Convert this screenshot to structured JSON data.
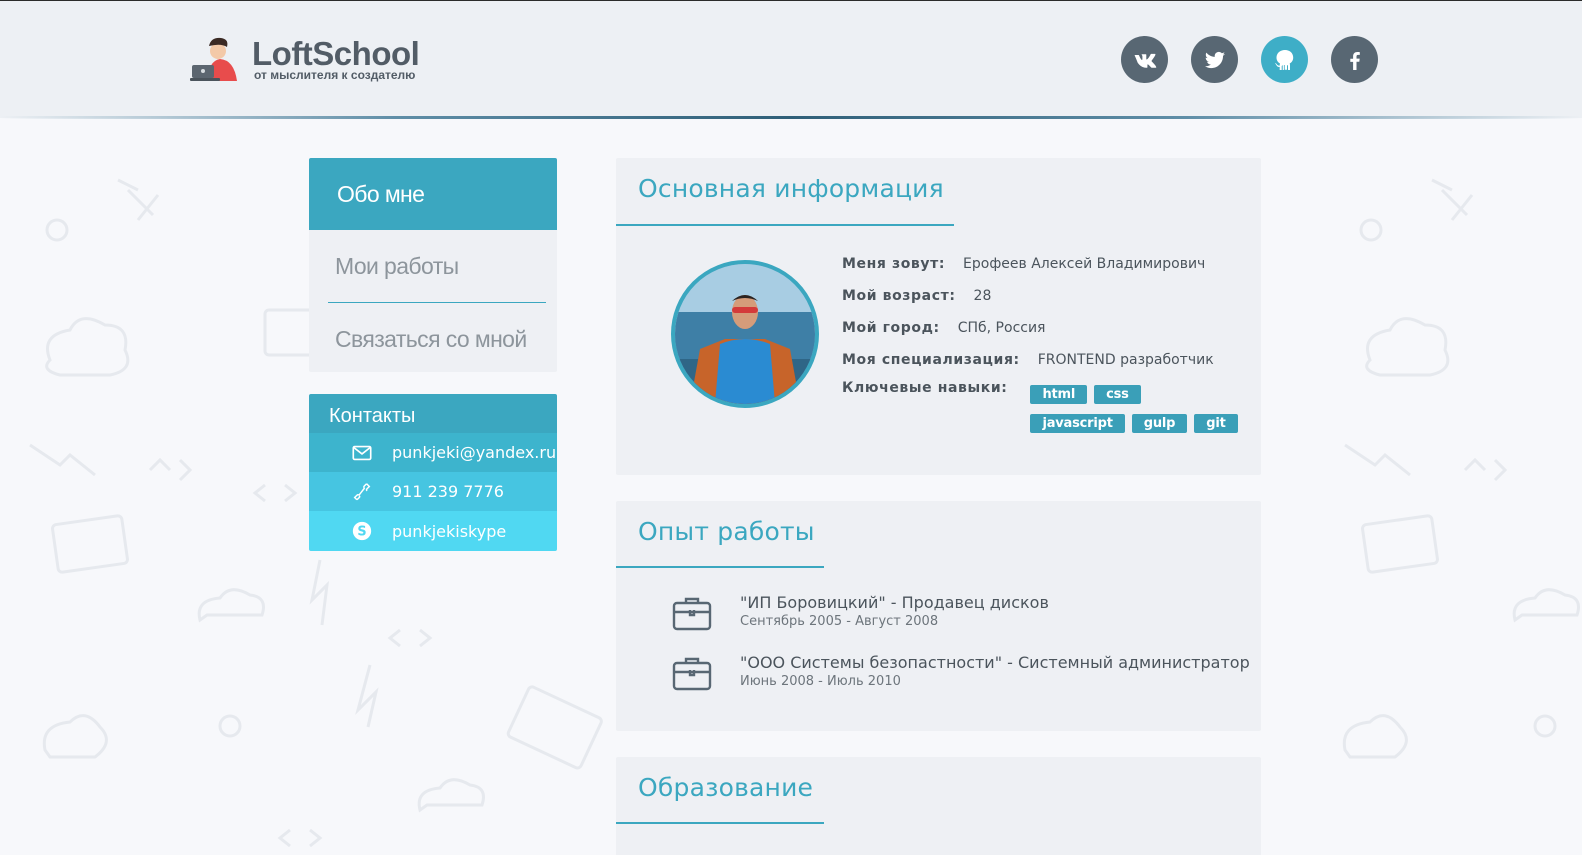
{
  "header": {
    "logo_title": "LoftSchool",
    "logo_subtitle": "от мыслителя к создателю",
    "socials": [
      {
        "name": "vk",
        "icon": "vk-icon",
        "active": false
      },
      {
        "name": "twitter",
        "icon": "twitter-icon",
        "active": false
      },
      {
        "name": "github",
        "icon": "github-icon",
        "active": true
      },
      {
        "name": "facebook",
        "icon": "facebook-icon",
        "active": false
      }
    ]
  },
  "nav": {
    "items": [
      {
        "label": "Обо мне",
        "active": true
      },
      {
        "label": "Мои работы",
        "active": false
      },
      {
        "label": "Связаться со мной",
        "active": false
      }
    ]
  },
  "contacts": {
    "title": "Контакты",
    "email": "punkjeki@yandex.ru",
    "phone": "911 239 7776",
    "skype": "punkjekiskype"
  },
  "info": {
    "title": "Основная информация",
    "rows": [
      {
        "label": "Меня зовут:",
        "value": "Ерофеев Алексей Владимирович"
      },
      {
        "label": "Мой возраст:",
        "value": "28"
      },
      {
        "label": "Мой город:",
        "value": "СПб, Россия"
      },
      {
        "label": "Моя специализация:",
        "value": "FRONTEND разработчик"
      }
    ],
    "skills_label": "Ключевые навыки:",
    "skills": [
      "html",
      "css",
      "javascript",
      "gulp",
      "git"
    ]
  },
  "experience": {
    "title": "Опыт работы",
    "jobs": [
      {
        "title": "\"ИП Боровицкий\" - Продавец дисков",
        "period": "Сентябрь 2005 - Август 2008"
      },
      {
        "title": "\"ООО Системы безопастности\" - Системный администратор",
        "period": "Июнь 2008 - Июль 2010"
      }
    ]
  },
  "education": {
    "title": "Образование"
  },
  "colors": {
    "accent": "#3ba7c0",
    "header_bg": "#edf0f4",
    "social_bg": "#586773",
    "social_active": "#3eaec7"
  }
}
